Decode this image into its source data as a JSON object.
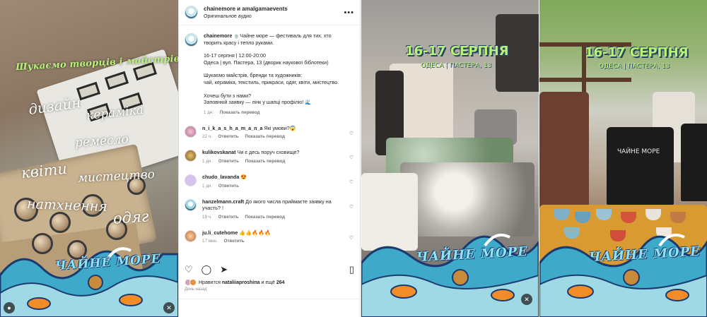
{
  "left_reel": {
    "tagline": "Шукаємо творців і майстрів",
    "keywords": [
      "дизайн",
      "кераміка",
      "ремесло",
      "квіти",
      "мистецтво",
      "натхнення",
      "одяг"
    ],
    "brand": "ЧАЙНЕ МОРЕ",
    "icons": [
      "reel-user-icon",
      "mute-icon"
    ]
  },
  "post": {
    "header_title": "chainemore и amalgamaevents",
    "header_sub": "Оригинальное аудио",
    "caption": {
      "username": "chainemore",
      "text_line1": "🍵Чайне море — фестиваль для тих, хто творить красу і тепло руками.",
      "text_block2": "16-17 серпня | 12:00-20:00\nОдеса | вул. Пастера, 13 (дворик наукової біблотеки)",
      "text_block3": "Шукаємо майстрів, бренди та художників:\nчай, кераміка, текстиль, прикраси, одяг, квіти, мистецтво.",
      "text_block4": "Хочеш бути з нами?\nЗаповнюй заявку — лінк у шапці профілю! 🌊",
      "age": "1 дн.",
      "translate": "Показать перевод"
    },
    "comments": [
      {
        "username": "n_i_k_a_s_h_a_m_a_n_a",
        "text": "Які умови?😱",
        "age": "22 ч.",
        "reply": "Ответить",
        "translate": "Показать перевод"
      },
      {
        "username": "kulikovskanat",
        "text": "Чи є десь поруч сховище?",
        "age": "1 дн.",
        "reply": "Ответить",
        "translate": "Показать перевод"
      },
      {
        "username": "chudo_lavanda",
        "text": "😍",
        "age": "1 дн.",
        "reply": "Ответить",
        "translate": ""
      },
      {
        "username": "hanzelmann.craft",
        "text": "До якого числа приймаєте заявку на участь? !",
        "age": "19 ч.",
        "reply": "Ответить",
        "translate": "Показать перевод"
      },
      {
        "username": "ju.li_cutehome",
        "text": "👍👍🔥🔥🔥",
        "age": "17 мин.",
        "reply": "Ответить",
        "translate": ""
      }
    ],
    "likes_prefix": "Нравится",
    "likes_user": "nataliiaproshina",
    "likes_suffix": "и ещё",
    "likes_count": "264",
    "date": "День назад",
    "icons": [
      "heart-icon",
      "comment-icon",
      "share-icon",
      "bookmark-icon",
      "more-icon"
    ]
  },
  "mid_reel": {
    "date_title": "16-17 СЕРПНЯ",
    "address": "ОДЕСА | ПАСТЕРА, 13",
    "brand": "ЧАЙНЕ МОРЕ"
  },
  "right_reel": {
    "date_title": "16-17 СЕРПНЯ",
    "address": "ОДЕСА | ПАСТЕРА, 13",
    "brand": "ЧАЙНЕ МОРЕ",
    "shirt_text": "ЧАЙНЕ МОРЕ"
  },
  "colors": {
    "accent_green": "#b9f27a",
    "wave_blue": "#3fa9c9",
    "wave_dark": "#1b3a6e",
    "text": "#262626",
    "muted": "#8e8e8e"
  }
}
